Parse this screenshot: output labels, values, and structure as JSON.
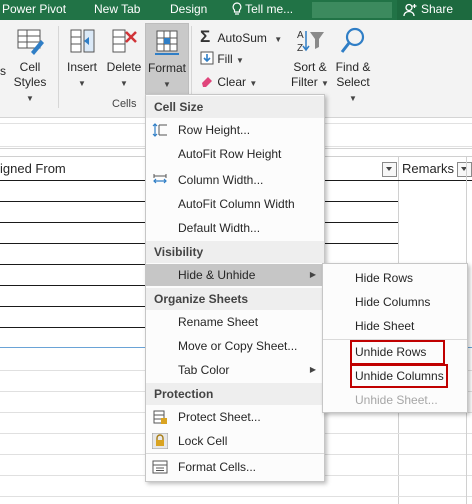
{
  "tabs": {
    "power_pivot": "Power Pivot",
    "new_tab": "New Tab",
    "design": "Design",
    "tell_me": "Tell me...",
    "share": "Share"
  },
  "ribbon": {
    "cell_styles_top": "Cell",
    "cell_styles_bottom": "Styles",
    "insert": "Insert",
    "delete": "Delete",
    "format": "Format",
    "cells_group": "Cells",
    "autosum": "AutoSum",
    "fill": "Fill",
    "clear": "Clear",
    "sort_top": "Sort &",
    "sort_bottom": "Filter",
    "find_top": "Find &",
    "find_bottom": "Select",
    "left_cut": "s"
  },
  "sheet": {
    "col_assigned_from": "igned From",
    "col_remarks": "Remarks"
  },
  "menu": {
    "sections": {
      "cell_size": "Cell Size",
      "visibility": "Visibility",
      "organize": "Organize Sheets",
      "protection": "Protection"
    },
    "items": {
      "row_height": "Row Height...",
      "autofit_row": "AutoFit Row Height",
      "column_width": "Column Width...",
      "autofit_column": "AutoFit Column Width",
      "default_width": "Default Width...",
      "hide_unhide": "Hide & Unhide",
      "rename_sheet": "Rename Sheet",
      "move_copy": "Move or Copy Sheet...",
      "tab_color": "Tab Color",
      "protect_sheet": "Protect Sheet...",
      "lock_cell": "Lock Cell",
      "format_cells": "Format Cells..."
    }
  },
  "submenu": {
    "hide_rows": "Hide Rows",
    "hide_columns": "Hide Columns",
    "hide_sheet": "Hide Sheet",
    "unhide_rows": "Unhide Rows",
    "unhide_columns": "Unhide Columns",
    "unhide_sheet": "Unhide Sheet..."
  },
  "colors": {
    "excel_green": "#217346",
    "highlight_red": "#c00000",
    "hover_gray": "#c6c6c6"
  }
}
